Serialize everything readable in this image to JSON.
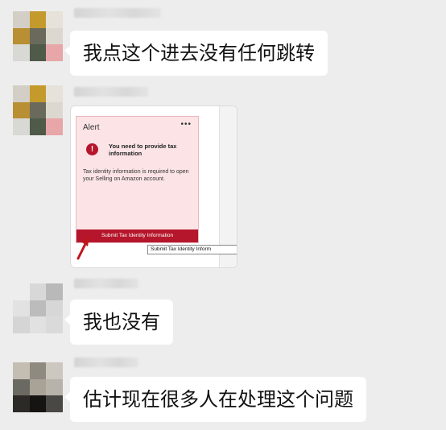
{
  "messages": [
    {
      "type": "text",
      "text": "我点这个进去没有任何跳转"
    },
    {
      "type": "image"
    },
    {
      "type": "text",
      "text": "我也没有"
    },
    {
      "type": "text",
      "text": "估计现在很多人在处理这个问题"
    }
  ],
  "screenshot": {
    "alert_title": "Alert",
    "more": "•••",
    "icon_glyph": "!",
    "heading": "You need to provide tax information",
    "body": "Tax identity information is required to open your Selling on Amazon account.",
    "button": "Submit Tax Identity Information",
    "tooltip": "Submit Tax Identity Inform"
  },
  "colors": {
    "background": "#ededed",
    "bubble": "#ffffff",
    "alert_bg": "#fce4e6",
    "alert_accent": "#b5162b"
  }
}
